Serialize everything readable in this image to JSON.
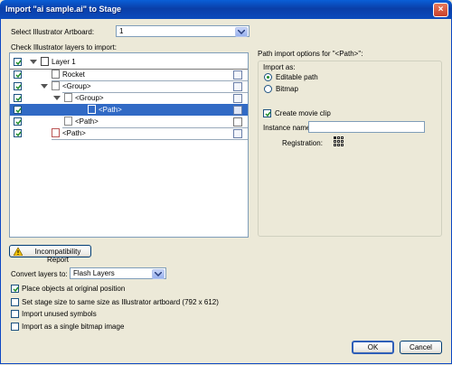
{
  "window": {
    "title": "Import \"ai sample.ai\" to Stage",
    "close_glyph": "×"
  },
  "artboard": {
    "label": "Select Illustrator Artboard:",
    "value": "1"
  },
  "layers": {
    "label": "Check Illustrator layers to import:",
    "rows": [
      {
        "label": "Layer 1",
        "icon": "layer-icon",
        "checked": true,
        "selected": false
      },
      {
        "label": "Rocket",
        "icon": "object-icon",
        "checked": true,
        "selected": false
      },
      {
        "label": "<Group>",
        "icon": "group-icon",
        "checked": true,
        "selected": false
      },
      {
        "label": "<Group>",
        "icon": "group-icon",
        "checked": true,
        "selected": false
      },
      {
        "label": "<Path>",
        "icon": "path-icon",
        "checked": true,
        "selected": true
      },
      {
        "label": "<Path>",
        "icon": "path-icon",
        "checked": true,
        "selected": false
      },
      {
        "label": "<Path>",
        "icon": "path-icon",
        "checked": true,
        "selected": false
      }
    ]
  },
  "path_options": {
    "title": "Path import options for \"<Path>\":",
    "import_as_label": "Import as:",
    "editable_path": "Editable path",
    "bitmap": "Bitmap",
    "create_movie_clip": "Create movie clip",
    "instance_name_label": "Instance name:",
    "instance_name_value": "",
    "registration_label": "Registration:"
  },
  "incompat": {
    "label": "Incompatibility Report"
  },
  "convert": {
    "label": "Convert layers to:",
    "value": "Flash Layers"
  },
  "options": [
    {
      "label": "Place objects at original position",
      "checked": true
    },
    {
      "label": "Set stage size to same size as Illustrator artboard (792 x 612)",
      "checked": false
    },
    {
      "label": "Import unused symbols",
      "checked": false
    },
    {
      "label": "Import as a single bitmap image",
      "checked": false
    }
  ],
  "buttons": {
    "ok": "OK",
    "cancel": "Cancel"
  }
}
